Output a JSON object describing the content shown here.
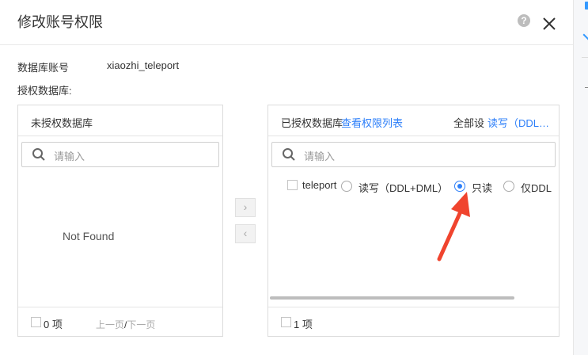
{
  "dialog": {
    "title": "修改账号权限",
    "help_icon": "?",
    "account_label": "数据库账号",
    "account_value": "xiaozhi_teleport",
    "authorized_db_label": "授权数据库:"
  },
  "left_panel": {
    "title": "未授权数据库",
    "search_placeholder": "请输入",
    "empty_text": "Not Found",
    "count": "0 项",
    "prev_page": "上一页",
    "separator": "/",
    "next_page": "下一页"
  },
  "transfer": {
    "right_arrow": "›",
    "left_arrow": "‹"
  },
  "right_panel": {
    "title": "已授权数据库",
    "view_perm_link": "查看权限列表",
    "set_all_label": "全部设",
    "set_all_option": "读写（DDL…",
    "search_placeholder": "请输入",
    "items": [
      {
        "name": "teleport",
        "options": [
          {
            "label": "读写（DDL+DML）",
            "selected": false
          },
          {
            "label": "只读",
            "selected": true
          },
          {
            "label": "仅DDL",
            "selected": false
          }
        ]
      }
    ],
    "count": "1 项"
  },
  "colors": {
    "accent": "#2d7ff9",
    "annotation_arrow": "#f0442e"
  },
  "icons": [
    "help-icon",
    "close-icon",
    "search-icon",
    "arrow-right-icon",
    "arrow-left-icon"
  ]
}
